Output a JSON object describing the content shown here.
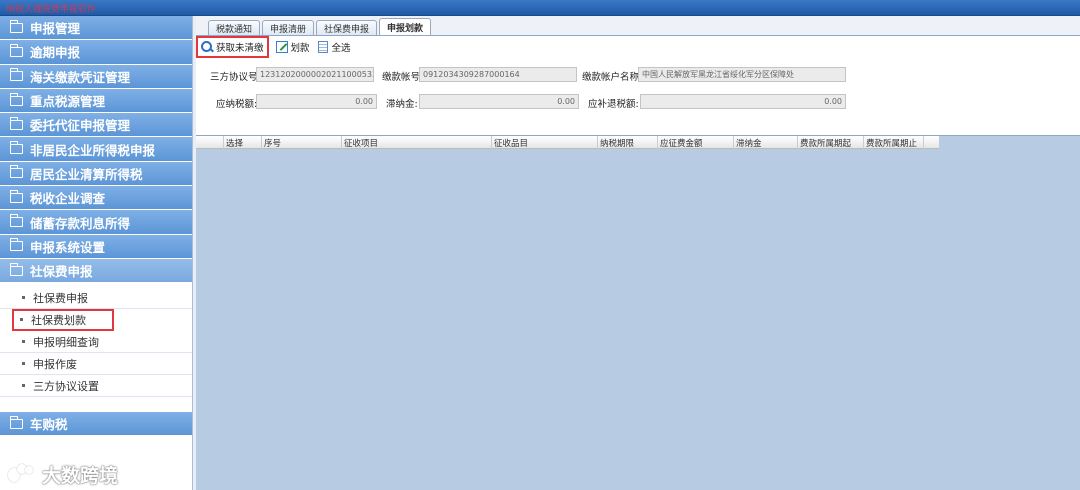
{
  "window": {
    "title": "纳税人端税费申报软件"
  },
  "sidebar": {
    "items": [
      {
        "label": "申报管理"
      },
      {
        "label": "逾期申报"
      },
      {
        "label": "海关缴款凭证管理"
      },
      {
        "label": "重点税源管理"
      },
      {
        "label": "委托代征申报管理"
      },
      {
        "label": "非居民企业所得税申报"
      },
      {
        "label": "居民企业清算所得税"
      },
      {
        "label": "税收企业调查"
      },
      {
        "label": "储蓄存款利息所得"
      },
      {
        "label": "申报系统设置"
      }
    ],
    "expanded": {
      "label": "社保费申报",
      "children": [
        {
          "label": "社保费申报"
        },
        {
          "label": "社保费划款"
        },
        {
          "label": "申报明细查询"
        },
        {
          "label": "申报作废"
        },
        {
          "label": "三方协议设置"
        }
      ]
    },
    "bottom_item": {
      "label": "车购税"
    }
  },
  "watermark": {
    "text": "大数跨境"
  },
  "tabs": [
    {
      "label": "税款通知"
    },
    {
      "label": "申报清册"
    },
    {
      "label": "社保费申报"
    },
    {
      "label": "申报划款"
    }
  ],
  "toolbar": {
    "fetch_label": "获取未清缴",
    "transfer_label": "划款",
    "select_all_label": "全选"
  },
  "form": {
    "agreement_no_label": "三方协议号:",
    "agreement_no_value": "12312020000020211000533",
    "account_no_label": "缴款帐号:",
    "account_no_value": "0912034309287000164",
    "account_name_label": "缴款帐户名称:",
    "account_name_value": "中国人民解放军黑龙江省绥化军分区保障处",
    "payable_label": "应纳税额:",
    "payable_value": "0.00",
    "late_fee_label": "滞纳金:",
    "late_fee_value": "0.00",
    "refund_label": "应补退税额:",
    "refund_value": "0.00"
  },
  "grid": {
    "columns": [
      "",
      "选择",
      "序号",
      "征收项目",
      "征收品目",
      "纳税期限",
      "应征费金额",
      "滞纳金",
      "费款所属期起",
      "费款所属期止"
    ]
  }
}
